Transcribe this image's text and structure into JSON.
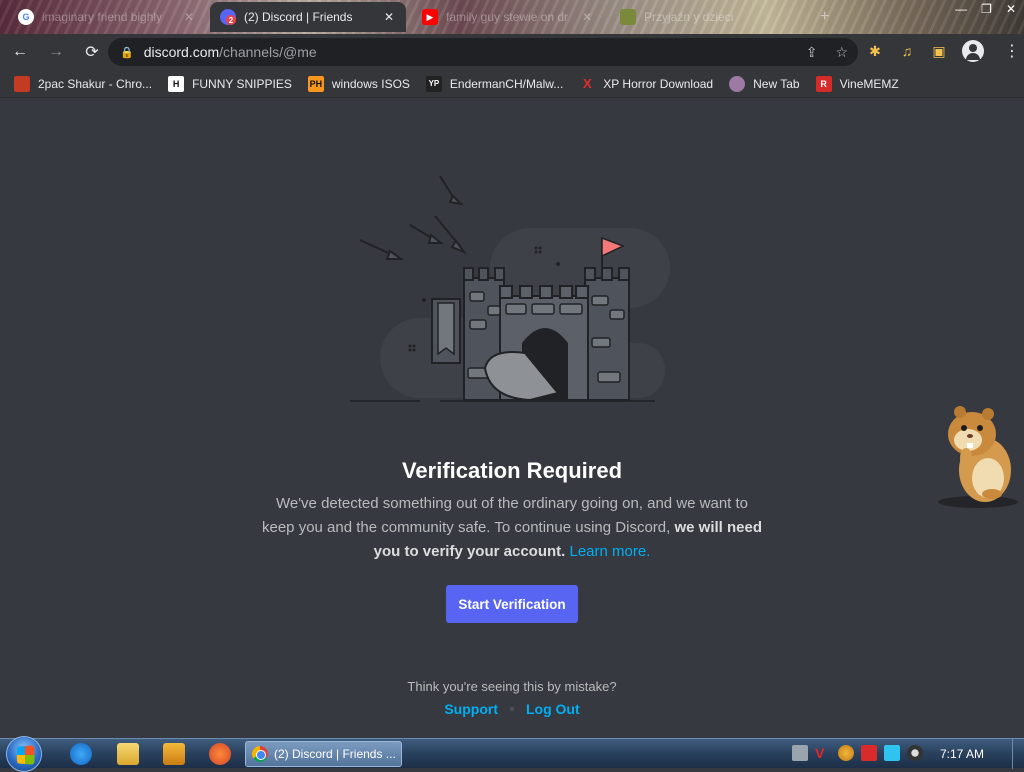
{
  "browser": {
    "tabs": [
      {
        "title": "imaginary friend bighly",
        "active": false
      },
      {
        "title": "(2) Discord | Friends",
        "active": true
      },
      {
        "title": "family guy stewie on dr",
        "active": false
      },
      {
        "title": "Przyjaźn y dzieci",
        "active": false
      }
    ],
    "favicon_badge": "2",
    "url_domain": "discord.com",
    "url_path": "/channels/@me",
    "bookmarks": [
      {
        "label": "2pac Shakur - Chro...",
        "icon": "tupac-icon",
        "icon_text": "",
        "color": "#c23b22"
      },
      {
        "label": "FUNNY SNIPPIES",
        "icon": "h-icon",
        "icon_text": "H",
        "color": "#111111"
      },
      {
        "label": "windows ISOS",
        "icon": "ph-icon",
        "icon_text": "PH",
        "color": "#f7971d"
      },
      {
        "label": "EndermanCH/Malw...",
        "icon": "yp-icon",
        "icon_text": "YP",
        "color": "#222222"
      },
      {
        "label": "XP Horror Download",
        "icon": "x-icon",
        "icon_text": "X",
        "color": "#e52b2b"
      },
      {
        "label": "New Tab",
        "icon": "avatar-icon",
        "icon_text": "",
        "color": "#9c7aa4"
      },
      {
        "label": "VineMEMZ",
        "icon": "r-icon",
        "icon_text": "R",
        "color": "#d62b2b"
      }
    ]
  },
  "discord": {
    "heading": "Verification Required",
    "desc_intro": "We've detected something out of the ordinary going on, and we want to keep you and the community safe. To continue using Discord,",
    "desc_bold": "we will need you to verify your account.",
    "learn_more": "Learn more.",
    "start_button": "Start Verification",
    "mistake_text": "Think you're seeing this by mistake?",
    "support_link": "Support",
    "logout_link": "Log Out"
  },
  "taskbar": {
    "task_label": "(2) Discord | Friends ...",
    "clock": "7:17 AM"
  },
  "colors": {
    "accent": "#5865f2",
    "link": "#00b0f4",
    "background": "#36393f"
  }
}
